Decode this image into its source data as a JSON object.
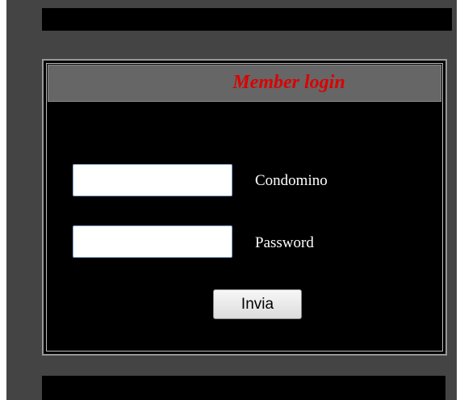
{
  "login": {
    "title": "Member login",
    "username_label": "Condomino",
    "username_value": "",
    "password_label": "Password",
    "password_value": "",
    "submit_label": "Invia"
  },
  "colors": {
    "title_red": "#dd0000",
    "panel_background": "#000000",
    "header_gray": "#666666",
    "page_gray": "#444444"
  }
}
